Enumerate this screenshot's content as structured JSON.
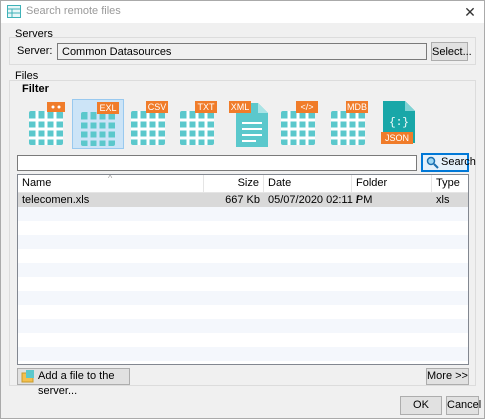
{
  "window": {
    "title": "Search remote files"
  },
  "servers": {
    "group_label": "Servers",
    "server_label": "Server:",
    "server_value": "Common Datasources",
    "select_button": "Select..."
  },
  "files": {
    "group_label": "Files",
    "filter_label": "Filter",
    "filters": [
      {
        "name": "generic",
        "badge": "",
        "selected": false
      },
      {
        "name": "excel",
        "badge": "EXL",
        "selected": true
      },
      {
        "name": "csv",
        "badge": "CSV",
        "selected": false
      },
      {
        "name": "txt",
        "badge": "TXT",
        "selected": false
      },
      {
        "name": "xml",
        "badge": "XML",
        "selected": false
      },
      {
        "name": "html",
        "badge": "</>",
        "selected": false
      },
      {
        "name": "mdb",
        "badge": "MDB",
        "selected": false
      },
      {
        "name": "json",
        "badge": "JSON",
        "selected": false
      }
    ],
    "search_value": "",
    "search_button": "Search",
    "columns": [
      "Name",
      "Size",
      "Date",
      "Folder",
      "Type"
    ],
    "rows": [
      {
        "name": "telecomen.xls",
        "size": "667 Kb",
        "date": "05/07/2020 02:11 PM",
        "folder": "/",
        "type": "xls"
      }
    ],
    "add_file_button": "Add a file to the server...",
    "more_button": "More >>"
  },
  "footer": {
    "ok_button": "OK",
    "cancel_button": "Cancel"
  },
  "colors": {
    "accent": "#0078d7",
    "grid_icon": "#5bc8cc",
    "badge": "#f07c2a",
    "selected_fill": "#cce4f7"
  }
}
